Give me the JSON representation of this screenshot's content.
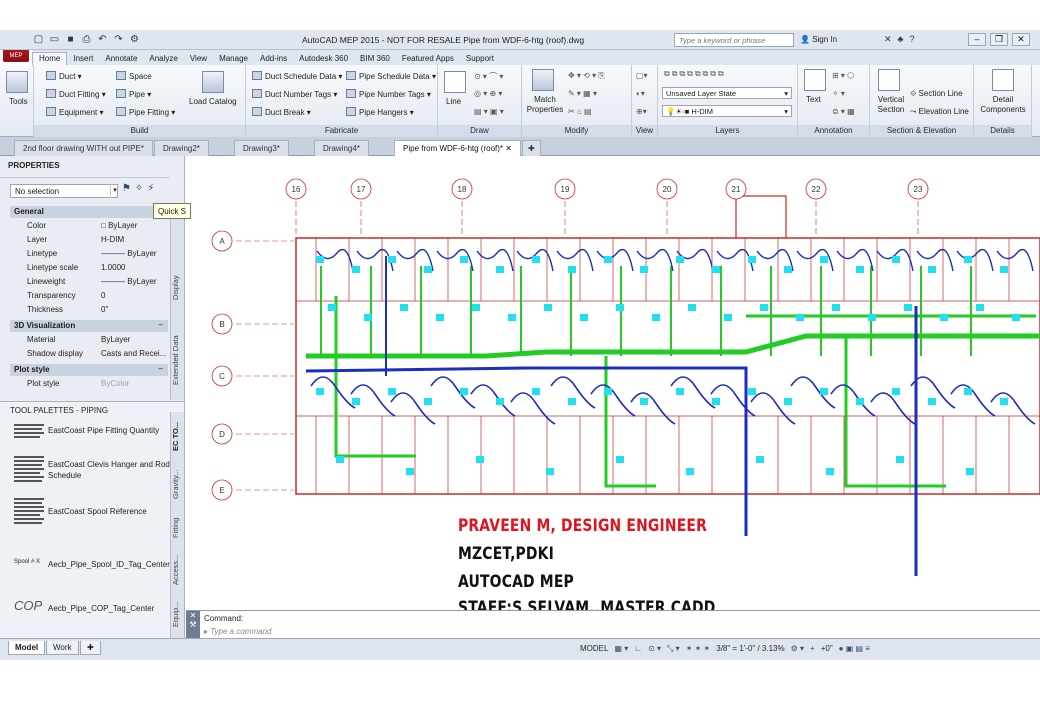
{
  "app": {
    "button_label": "MEP",
    "title": "AutoCAD MEP 2015 - NOT FOR RESALE   Pipe from WDF-6-htg (roof).dwg",
    "search_placeholder": "Type a keyword or phrase",
    "sign_in": "Sign In"
  },
  "ribbon_tabs": [
    "Home",
    "Insert",
    "Annotate",
    "Analyze",
    "View",
    "Manage",
    "Add-ins",
    "Autodesk 360",
    "BIM 360",
    "Featured Apps",
    "Support"
  ],
  "ribbon": {
    "tools": "Tools",
    "build": {
      "label": "Build",
      "duct": "Duct",
      "duct_fitting": "Duct Fitting",
      "equipment": "Equipment",
      "space": "Space",
      "pipe": "Pipe",
      "pipe_fitting": "Pipe Fitting",
      "load_catalog": "Load Catalog"
    },
    "fabricate": {
      "label": "Fabricate",
      "duct_schedule_data": "Duct Schedule Data",
      "duct_number_tags": "Duct Number Tags",
      "duct_break": "Duct Break",
      "pipe_schedule_data": "Pipe Schedule Data",
      "pipe_number_tags": "Pipe Number Tags",
      "pipe_hangers": "Pipe Hangers"
    },
    "draw": {
      "label": "Draw",
      "line": "Line"
    },
    "modify": {
      "label": "Modify",
      "match_properties": "Match Properties"
    },
    "view": {
      "label": "View"
    },
    "layers": {
      "label": "Layers",
      "layer_state": "Unsaved Layer State",
      "current_layer": "H-DIM"
    },
    "annotation": {
      "label": "Annotation",
      "text": "Text"
    },
    "section": {
      "label": "Section & Elevation",
      "vertical_section": "Vertical Section",
      "section_line": "Section Line",
      "elevation_line": "Elevation Line"
    },
    "details": {
      "label": "Details",
      "detail_components": "Detail Components"
    }
  },
  "doc_tabs": [
    "2nd floor drawing WITH out PIPE*",
    "Drawing2*",
    "Drawing3*",
    "Drawing4*",
    "Pipe from WDF-6-htg (roof)*"
  ],
  "properties": {
    "title": "PROPERTIES",
    "selection": "No selection",
    "quick_select": "Quick S",
    "groups": [
      {
        "name": "General",
        "rows": [
          {
            "key": "Color",
            "value": "ByLayer"
          },
          {
            "key": "Layer",
            "value": "H-DIM"
          },
          {
            "key": "Linetype",
            "value": "ByLayer"
          },
          {
            "key": "Linetype scale",
            "value": "1.0000"
          },
          {
            "key": "Lineweight",
            "value": "ByLayer"
          },
          {
            "key": "Transparency",
            "value": "0"
          },
          {
            "key": "Thickness",
            "value": "0\""
          }
        ]
      },
      {
        "name": "3D Visualization",
        "rows": [
          {
            "key": "Material",
            "value": "ByLayer"
          },
          {
            "key": "Shadow display",
            "value": "Casts and Recei..."
          }
        ]
      },
      {
        "name": "Plot style",
        "rows": [
          {
            "key": "Plot style",
            "value": "ByColor"
          }
        ]
      }
    ],
    "side_tabs": [
      "Display",
      "Extended Data"
    ]
  },
  "palettes": {
    "title": "TOOL PALETTES - PIPING",
    "items": [
      "EastCoast Pipe Fitting Quantity",
      "EastCoast Clevis Hanger and Rod Schedule",
      "EastCoast Spool Reference",
      "Aecb_Pipe_Spool_ID_Tag_Center",
      "Aecb_Pipe_COP_Tag_Center"
    ],
    "spool_thumb": "Spool # X",
    "cop_thumb": "COP",
    "side_tabs": [
      "EC TO...",
      "Gravity...",
      "Fitting",
      "Access...",
      "Equip..."
    ]
  },
  "drawing": {
    "column_grid": [
      "16",
      "17",
      "18",
      "19",
      "20",
      "21",
      "22",
      "23"
    ],
    "row_grid": [
      "A",
      "B",
      "C",
      "D",
      "E"
    ],
    "credits": [
      {
        "text": "PRAVEEN  M, DESIGN ENGINEER",
        "color": "#e0141e"
      },
      {
        "text": "MZCET,PDKI",
        "color": "#111111"
      },
      {
        "text": "AUTOCAD MEP",
        "color": "#111111"
      },
      {
        "text": "STAFF:S  SELVAM.,MASTER  CADD",
        "color": "#111111"
      }
    ]
  },
  "command": {
    "label": "Command:",
    "placeholder": "Type a command"
  },
  "layout_tabs": [
    "Model",
    "Work"
  ],
  "status": {
    "mode": "MODEL",
    "scale": "3/8\" = 1'-0\" / 3.13%",
    "rotation": "+0\""
  },
  "colors": {
    "pipe_green": "#22cc22",
    "pipe_blue": "#1a2fbf",
    "terminal_cyan": "#22e0f0",
    "wall_red": "#cc2a2a",
    "accent_red": "#e0141e"
  }
}
